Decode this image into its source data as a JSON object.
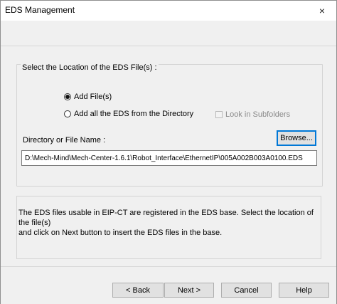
{
  "window": {
    "title": "EDS Management",
    "close_glyph": "×"
  },
  "location_group": {
    "label": "Select the Location of the EDS File(s) :",
    "radio_add_files": "Add File(s)",
    "radio_add_all": "Add all the EDS from the Directory",
    "checkbox_subfolders": "Look in Subfolders",
    "selected_radio": "Add File(s)",
    "subfolders_checked": false,
    "subfolders_enabled": false,
    "path_label": "Directory or File Name :",
    "browse_label": "Browse...",
    "path_value": "D:\\Mech-Mind\\Mech-Center-1.6.1\\Robot_Interface\\EthernetIP\\005A002B003A0100.EDS"
  },
  "info": {
    "line1": "The EDS files usable in EIP-CT are registered in the EDS base. Select the location of the file(s)",
    "line2": "and click on Next button to insert the EDS files in the base."
  },
  "footer": {
    "back_label": "<   Back",
    "next_label": "Next   >",
    "cancel_label": "Cancel",
    "help_label": "Help"
  }
}
